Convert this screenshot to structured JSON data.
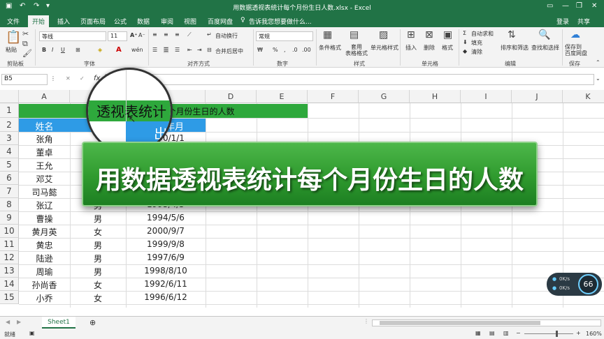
{
  "window": {
    "title": "用数据透视表统计每个月份生日人数.xlsx - Excel",
    "login": "登录",
    "share": "共享"
  },
  "tabs": [
    "文件",
    "开始",
    "插入",
    "页面布局",
    "公式",
    "数据",
    "审阅",
    "视图",
    "百度网盘"
  ],
  "tell_me": "告诉我您想要做什么...",
  "ribbon": {
    "groups": {
      "clipboard": "剪贴板",
      "font": "字体",
      "alignment": "对齐方式",
      "number": "数字",
      "styles": "样式",
      "cells": "单元格",
      "editing": "编辑",
      "save": "保存"
    },
    "paste": "粘贴",
    "font_name": "等线",
    "font_size": "11",
    "wrap_text": "自动换行",
    "merge_center": "合并后居中",
    "number_format": "常规",
    "conditional_format": "条件格式",
    "format_as_table": "套用\n表格格式",
    "cell_styles": "单元格样式",
    "insert": "插入",
    "delete": "删除",
    "format": "格式",
    "autosum": "自动求和",
    "fill": "填充",
    "clear": "清除",
    "sort_filter": "排序和筛选",
    "find_select": "查找和选择",
    "save_baidu": "保存到\n百度网盘"
  },
  "formula_bar": {
    "name_box": "B5",
    "fx": "fx",
    "formula": ""
  },
  "columns": [
    "A",
    "B",
    "C",
    "D",
    "E",
    "F",
    "G",
    "H",
    "I",
    "J",
    "K"
  ],
  "rows": [
    "1",
    "2",
    "3",
    "4",
    "5",
    "6",
    "7",
    "8",
    "9",
    "10",
    "11",
    "12",
    "13",
    "14",
    "15"
  ],
  "sheet": {
    "title_cell": "用数据透视表统计每个月份生日的人数",
    "headers": [
      "姓名",
      "性别",
      "出生年月"
    ],
    "data": [
      [
        "张角",
        "",
        "1990/1/1"
      ],
      [
        "董卓",
        "",
        ""
      ],
      [
        "王允",
        "",
        ""
      ],
      [
        "邓艾",
        "",
        ""
      ],
      [
        "司马懿",
        "",
        ""
      ],
      [
        "张辽",
        "男",
        "1995/4/5"
      ],
      [
        "曹操",
        "男",
        "1994/5/6"
      ],
      [
        "黄月英",
        "女",
        "2000/9/7"
      ],
      [
        "黄忠",
        "男",
        "1999/9/8"
      ],
      [
        "陆逊",
        "男",
        "1997/6/9"
      ],
      [
        "周瑜",
        "男",
        "1998/8/10"
      ],
      [
        "孙尚香",
        "女",
        "1992/6/11"
      ],
      [
        "小乔",
        "女",
        "1996/6/12"
      ]
    ]
  },
  "magnifier": {
    "title_fragment": "透视表统计",
    "row2_fragment_b": "别",
    "row2_fragment_c": "出"
  },
  "banner": {
    "text": "用数据透视表统计每个月份生日的人数"
  },
  "sheet_tabs": {
    "active": "Sheet1",
    "add": "⊕"
  },
  "status": {
    "ready": "就绪",
    "zoom": "160%"
  },
  "speed_widget": {
    "up": "0K/s",
    "down": "0K/s",
    "percent": "66"
  },
  "colors": {
    "excel_green": "#217346",
    "title_fill": "#2ea83c",
    "header_fill": "#2e9be6",
    "banner_green": "#2f9a2e"
  }
}
